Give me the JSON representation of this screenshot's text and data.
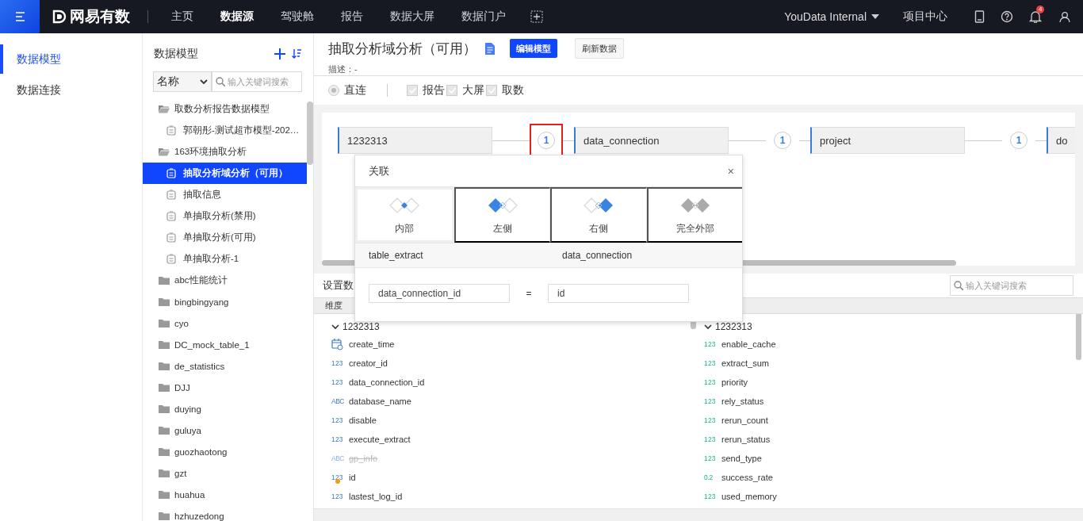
{
  "topbar": {
    "logo": "网易有数",
    "nav": [
      {
        "label": "主页",
        "selected": false
      },
      {
        "label": "数据源",
        "selected": true
      },
      {
        "label": "驾驶舱",
        "selected": false
      },
      {
        "label": "报告",
        "selected": false
      },
      {
        "label": "数据大屏",
        "selected": false
      },
      {
        "label": "数据门户",
        "selected": false
      }
    ],
    "workspace": "YouData Internal",
    "project_center": "项目中心",
    "notifications": "4"
  },
  "sidebar": {
    "items": [
      {
        "label": "数据模型",
        "selected": true
      },
      {
        "label": "数据连接",
        "selected": false
      }
    ]
  },
  "model_tree": {
    "title": "数据模型",
    "sort_select": "名称",
    "search": {
      "placeholder": "输入关键词搜索"
    },
    "items": [
      {
        "label": "取数分析报告数据模型",
        "kind": "folder",
        "expanded": true,
        "selected": false,
        "children": [
          {
            "label": "郭朝彤-测试超市模型-202…",
            "kind": "model",
            "selected": false
          }
        ]
      },
      {
        "label": "163环境抽取分析",
        "kind": "folder",
        "expanded": true,
        "selected": false,
        "children": [
          {
            "label": "抽取分析域分析（可用）",
            "kind": "model",
            "selected": true
          },
          {
            "label": "抽取信息",
            "kind": "model",
            "selected": false
          },
          {
            "label": "单抽取分析(禁用)",
            "kind": "model",
            "selected": false
          },
          {
            "label": "单抽取分析(可用)",
            "kind": "model",
            "selected": false
          },
          {
            "label": "单抽取分析-1",
            "kind": "model",
            "selected": false
          }
        ]
      },
      {
        "label": "abc性能统计",
        "kind": "folder",
        "expanded": false,
        "selected": false
      },
      {
        "label": "bingbingyang",
        "kind": "folder",
        "expanded": false,
        "selected": false
      },
      {
        "label": "cyo",
        "kind": "folder",
        "expanded": false,
        "selected": false
      },
      {
        "label": "DC_mock_table_1",
        "kind": "folder",
        "expanded": false,
        "selected": false
      },
      {
        "label": "de_statistics",
        "kind": "folder",
        "expanded": false,
        "selected": false
      },
      {
        "label": "DJJ",
        "kind": "folder",
        "expanded": false,
        "selected": false
      },
      {
        "label": "duying",
        "kind": "folder",
        "expanded": false,
        "selected": false
      },
      {
        "label": "guluya",
        "kind": "folder",
        "expanded": false,
        "selected": false
      },
      {
        "label": "guozhaotong",
        "kind": "folder",
        "expanded": false,
        "selected": false
      },
      {
        "label": "gzt",
        "kind": "folder",
        "expanded": false,
        "selected": false
      },
      {
        "label": "huahua",
        "kind": "folder",
        "expanded": false,
        "selected": false
      },
      {
        "label": "hzhuzedong",
        "kind": "folder",
        "expanded": false,
        "selected": false
      }
    ]
  },
  "model": {
    "title": "抽取分析域分析（可用）",
    "edit_button": "编辑模型",
    "refresh_button": "刷新数据",
    "description": "描述：-",
    "connection": {
      "label": "直连",
      "selected": true,
      "disabled": true
    },
    "usages": [
      {
        "label": "报告",
        "checked": true,
        "disabled": true
      },
      {
        "label": "大屏",
        "checked": true,
        "disabled": true
      },
      {
        "label": "取数",
        "checked": true,
        "disabled": true
      }
    ]
  },
  "canvas": {
    "nodes": [
      {
        "label": "1232313"
      },
      {
        "label": "data_connection"
      },
      {
        "label": "project"
      },
      {
        "label": "do"
      }
    ],
    "joins": [
      {
        "label": "1",
        "selected": true
      },
      {
        "label": "1",
        "selected": false
      },
      {
        "label": "1",
        "selected": false
      }
    ]
  },
  "join_dialog": {
    "title": "关联",
    "close": "×",
    "types": [
      {
        "label": "内部",
        "kind": "inner",
        "selected": true
      },
      {
        "label": "左侧",
        "kind": "left",
        "selected": false
      },
      {
        "label": "右侧",
        "kind": "right",
        "selected": false
      },
      {
        "label": "完全外部",
        "kind": "outer",
        "selected": false
      }
    ],
    "left_table": "table_extract",
    "right_table": "data_connection",
    "conditions": [
      {
        "left": "data_connection_id",
        "operator": "=",
        "right": "id"
      }
    ]
  },
  "fields": {
    "label": "设置数",
    "search": {
      "placeholder": "输入关键词搜索"
    },
    "column_header": "维度",
    "dimensions": {
      "group": "1232313",
      "expanded": true,
      "items": [
        {
          "name": "create_time",
          "kind": "date",
          "hidden": false,
          "key": false
        },
        {
          "name": "creator_id",
          "kind": "number",
          "type_label": "123",
          "hidden": false,
          "key": false
        },
        {
          "name": "data_connection_id",
          "kind": "number",
          "type_label": "123",
          "hidden": false,
          "key": false
        },
        {
          "name": "database_name",
          "kind": "text",
          "type_label": "ABC",
          "hidden": false,
          "key": false
        },
        {
          "name": "disable",
          "kind": "number",
          "type_label": "123",
          "hidden": false,
          "key": false
        },
        {
          "name": "execute_extract",
          "kind": "number",
          "type_label": "123",
          "hidden": false,
          "key": false
        },
        {
          "name": "gp_info",
          "kind": "text",
          "type_label": "ABC",
          "hidden": true,
          "key": false
        },
        {
          "name": "id",
          "kind": "number",
          "type_label": "123",
          "hidden": false,
          "key": true
        },
        {
          "name": "lastest_log_id",
          "kind": "number",
          "type_label": "123",
          "hidden": false,
          "key": false
        }
      ]
    },
    "measures": {
      "group": "1232313",
      "expanded": true,
      "items": [
        {
          "name": "enable_cache",
          "kind": "number",
          "type_label": "123",
          "hidden": false,
          "key": false
        },
        {
          "name": "extract_sum",
          "kind": "number",
          "type_label": "123",
          "hidden": false,
          "key": false
        },
        {
          "name": "priority",
          "kind": "number",
          "type_label": "123",
          "hidden": false,
          "key": false
        },
        {
          "name": "rely_status",
          "kind": "number",
          "type_label": "123",
          "hidden": false,
          "key": false
        },
        {
          "name": "rerun_count",
          "kind": "number",
          "type_label": "123",
          "hidden": false,
          "key": false
        },
        {
          "name": "rerun_status",
          "kind": "number",
          "type_label": "123",
          "hidden": false,
          "key": false
        },
        {
          "name": "send_type",
          "kind": "number",
          "type_label": "123",
          "hidden": false,
          "key": false
        },
        {
          "name": "success_rate",
          "kind": "decimal",
          "type_label": "0.2",
          "hidden": false,
          "key": false
        },
        {
          "name": "used_memory",
          "kind": "number",
          "type_label": "123",
          "hidden": false,
          "key": false
        }
      ]
    }
  }
}
